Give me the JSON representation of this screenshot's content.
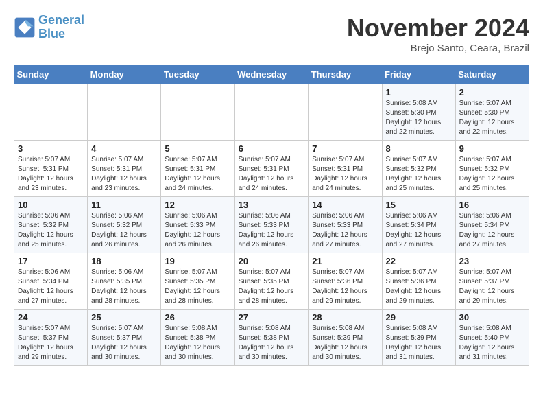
{
  "header": {
    "logo_line1": "General",
    "logo_line2": "Blue",
    "month": "November 2024",
    "location": "Brejo Santo, Ceara, Brazil"
  },
  "days_of_week": [
    "Sunday",
    "Monday",
    "Tuesday",
    "Wednesday",
    "Thursday",
    "Friday",
    "Saturday"
  ],
  "weeks": [
    [
      {
        "day": "",
        "info": ""
      },
      {
        "day": "",
        "info": ""
      },
      {
        "day": "",
        "info": ""
      },
      {
        "day": "",
        "info": ""
      },
      {
        "day": "",
        "info": ""
      },
      {
        "day": "1",
        "info": "Sunrise: 5:08 AM\nSunset: 5:30 PM\nDaylight: 12 hours and 22 minutes."
      },
      {
        "day": "2",
        "info": "Sunrise: 5:07 AM\nSunset: 5:30 PM\nDaylight: 12 hours and 22 minutes."
      }
    ],
    [
      {
        "day": "3",
        "info": "Sunrise: 5:07 AM\nSunset: 5:31 PM\nDaylight: 12 hours and 23 minutes."
      },
      {
        "day": "4",
        "info": "Sunrise: 5:07 AM\nSunset: 5:31 PM\nDaylight: 12 hours and 23 minutes."
      },
      {
        "day": "5",
        "info": "Sunrise: 5:07 AM\nSunset: 5:31 PM\nDaylight: 12 hours and 24 minutes."
      },
      {
        "day": "6",
        "info": "Sunrise: 5:07 AM\nSunset: 5:31 PM\nDaylight: 12 hours and 24 minutes."
      },
      {
        "day": "7",
        "info": "Sunrise: 5:07 AM\nSunset: 5:31 PM\nDaylight: 12 hours and 24 minutes."
      },
      {
        "day": "8",
        "info": "Sunrise: 5:07 AM\nSunset: 5:32 PM\nDaylight: 12 hours and 25 minutes."
      },
      {
        "day": "9",
        "info": "Sunrise: 5:07 AM\nSunset: 5:32 PM\nDaylight: 12 hours and 25 minutes."
      }
    ],
    [
      {
        "day": "10",
        "info": "Sunrise: 5:06 AM\nSunset: 5:32 PM\nDaylight: 12 hours and 25 minutes."
      },
      {
        "day": "11",
        "info": "Sunrise: 5:06 AM\nSunset: 5:32 PM\nDaylight: 12 hours and 26 minutes."
      },
      {
        "day": "12",
        "info": "Sunrise: 5:06 AM\nSunset: 5:33 PM\nDaylight: 12 hours and 26 minutes."
      },
      {
        "day": "13",
        "info": "Sunrise: 5:06 AM\nSunset: 5:33 PM\nDaylight: 12 hours and 26 minutes."
      },
      {
        "day": "14",
        "info": "Sunrise: 5:06 AM\nSunset: 5:33 PM\nDaylight: 12 hours and 27 minutes."
      },
      {
        "day": "15",
        "info": "Sunrise: 5:06 AM\nSunset: 5:34 PM\nDaylight: 12 hours and 27 minutes."
      },
      {
        "day": "16",
        "info": "Sunrise: 5:06 AM\nSunset: 5:34 PM\nDaylight: 12 hours and 27 minutes."
      }
    ],
    [
      {
        "day": "17",
        "info": "Sunrise: 5:06 AM\nSunset: 5:34 PM\nDaylight: 12 hours and 27 minutes."
      },
      {
        "day": "18",
        "info": "Sunrise: 5:06 AM\nSunset: 5:35 PM\nDaylight: 12 hours and 28 minutes."
      },
      {
        "day": "19",
        "info": "Sunrise: 5:07 AM\nSunset: 5:35 PM\nDaylight: 12 hours and 28 minutes."
      },
      {
        "day": "20",
        "info": "Sunrise: 5:07 AM\nSunset: 5:35 PM\nDaylight: 12 hours and 28 minutes."
      },
      {
        "day": "21",
        "info": "Sunrise: 5:07 AM\nSunset: 5:36 PM\nDaylight: 12 hours and 29 minutes."
      },
      {
        "day": "22",
        "info": "Sunrise: 5:07 AM\nSunset: 5:36 PM\nDaylight: 12 hours and 29 minutes."
      },
      {
        "day": "23",
        "info": "Sunrise: 5:07 AM\nSunset: 5:37 PM\nDaylight: 12 hours and 29 minutes."
      }
    ],
    [
      {
        "day": "24",
        "info": "Sunrise: 5:07 AM\nSunset: 5:37 PM\nDaylight: 12 hours and 29 minutes."
      },
      {
        "day": "25",
        "info": "Sunrise: 5:07 AM\nSunset: 5:37 PM\nDaylight: 12 hours and 30 minutes."
      },
      {
        "day": "26",
        "info": "Sunrise: 5:08 AM\nSunset: 5:38 PM\nDaylight: 12 hours and 30 minutes."
      },
      {
        "day": "27",
        "info": "Sunrise: 5:08 AM\nSunset: 5:38 PM\nDaylight: 12 hours and 30 minutes."
      },
      {
        "day": "28",
        "info": "Sunrise: 5:08 AM\nSunset: 5:39 PM\nDaylight: 12 hours and 30 minutes."
      },
      {
        "day": "29",
        "info": "Sunrise: 5:08 AM\nSunset: 5:39 PM\nDaylight: 12 hours and 31 minutes."
      },
      {
        "day": "30",
        "info": "Sunrise: 5:08 AM\nSunset: 5:40 PM\nDaylight: 12 hours and 31 minutes."
      }
    ]
  ]
}
